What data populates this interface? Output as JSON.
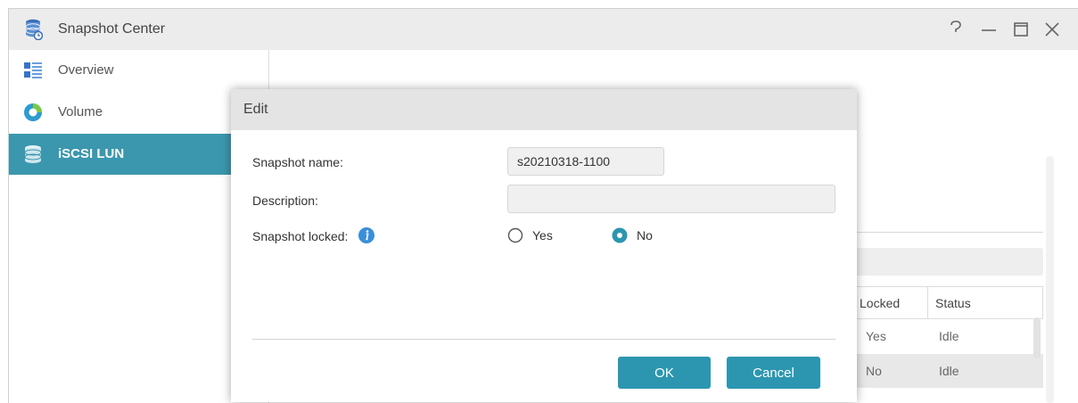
{
  "app": {
    "title": "Snapshot Center",
    "icon": "database-snapshot-icon"
  },
  "window_controls": [
    "help-icon",
    "minimize-icon",
    "maximize-icon",
    "close-icon"
  ],
  "sidebar": {
    "items": [
      {
        "label": "Overview",
        "icon": "overview-grid-icon",
        "active": false
      },
      {
        "label": "Volume",
        "icon": "volume-donut-icon",
        "active": true
      },
      {
        "label": "iSCSI LUN",
        "icon": "iscsi-lun-icon",
        "active": true
      }
    ]
  },
  "background_table": {
    "headers": [
      "Locked",
      "Status"
    ],
    "rows": [
      [
        "Yes",
        "Idle"
      ],
      [
        "No",
        "Idle"
      ]
    ]
  },
  "dialog": {
    "title": "Edit",
    "fields": {
      "snapshot_name_label": "Snapshot name:",
      "snapshot_name_value": "s20210318-1100",
      "description_label": "Description:",
      "description_value": "",
      "locked_label": "Snapshot locked:",
      "locked_options": [
        "Yes",
        "No"
      ],
      "locked_selected": "No"
    },
    "buttons": {
      "ok": "OK",
      "cancel": "Cancel"
    }
  },
  "colors": {
    "accent": "#2c96b0",
    "sidebar_active": "#3b97ad",
    "info": "#3a8fd8"
  }
}
